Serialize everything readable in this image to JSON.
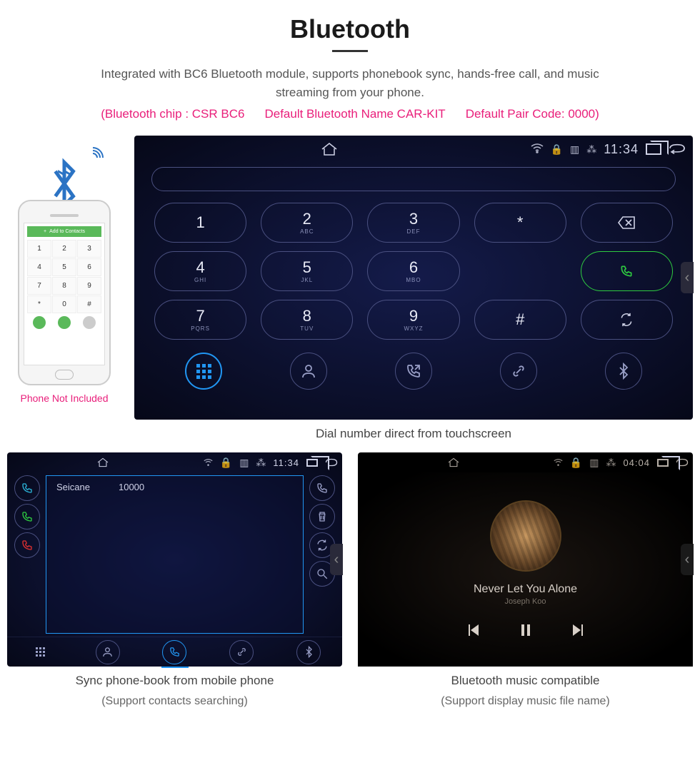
{
  "header": {
    "title": "Bluetooth",
    "desc": "Integrated with BC6 Bluetooth module, supports phonebook sync, hands-free call, and music streaming from your phone.",
    "spec_chip": "(Bluetooth chip : CSR BC6",
    "spec_name": "Default Bluetooth Name CAR-KIT",
    "spec_code": "Default Pair Code: 0000)"
  },
  "phone": {
    "top_label": "Add to Contacts",
    "keys": [
      "1",
      "2",
      "3",
      "4",
      "5",
      "6",
      "7",
      "8",
      "9",
      "*",
      "0",
      "#"
    ],
    "caption": "Phone Not Included"
  },
  "main_screen": {
    "status_time": "11:34",
    "keypad": [
      {
        "n": "1",
        "l": ""
      },
      {
        "n": "2",
        "l": "ABC"
      },
      {
        "n": "3",
        "l": "DEF"
      },
      {
        "n": "*",
        "l": ""
      },
      {
        "n": "backspace",
        "l": ""
      },
      {
        "n": "4",
        "l": "GHI"
      },
      {
        "n": "5",
        "l": "JKL"
      },
      {
        "n": "6",
        "l": "MBO"
      },
      {
        "n": "",
        "l": ""
      },
      {
        "n": "call",
        "l": ""
      },
      {
        "n": "7",
        "l": "PQRS"
      },
      {
        "n": "8",
        "l": "TUV"
      },
      {
        "n": "9",
        "l": "WXYZ"
      },
      {
        "n": "#",
        "l": ""
      },
      {
        "n": "swap",
        "l": ""
      }
    ],
    "nav_icons": [
      "dialpad",
      "contacts",
      "calllog",
      "pair",
      "bt"
    ],
    "caption": "Dial number direct from touchscreen"
  },
  "phonebook": {
    "status_time": "11:34",
    "contact_name": "Seicane",
    "contact_number": "10000",
    "left_colors": [
      "#2bb4d8",
      "#2ecc40",
      "#e03030"
    ],
    "nav_icons": [
      "dialpad",
      "contacts",
      "calllog",
      "pair",
      "bt"
    ],
    "caption1": "Sync phone-book from mobile phone",
    "caption2": "(Support contacts searching)"
  },
  "music": {
    "status_time": "04:04",
    "track": "Never Let You Alone",
    "artist": "Joseph Koo",
    "caption1": "Bluetooth music compatible",
    "caption2": "(Support display music file name)"
  }
}
